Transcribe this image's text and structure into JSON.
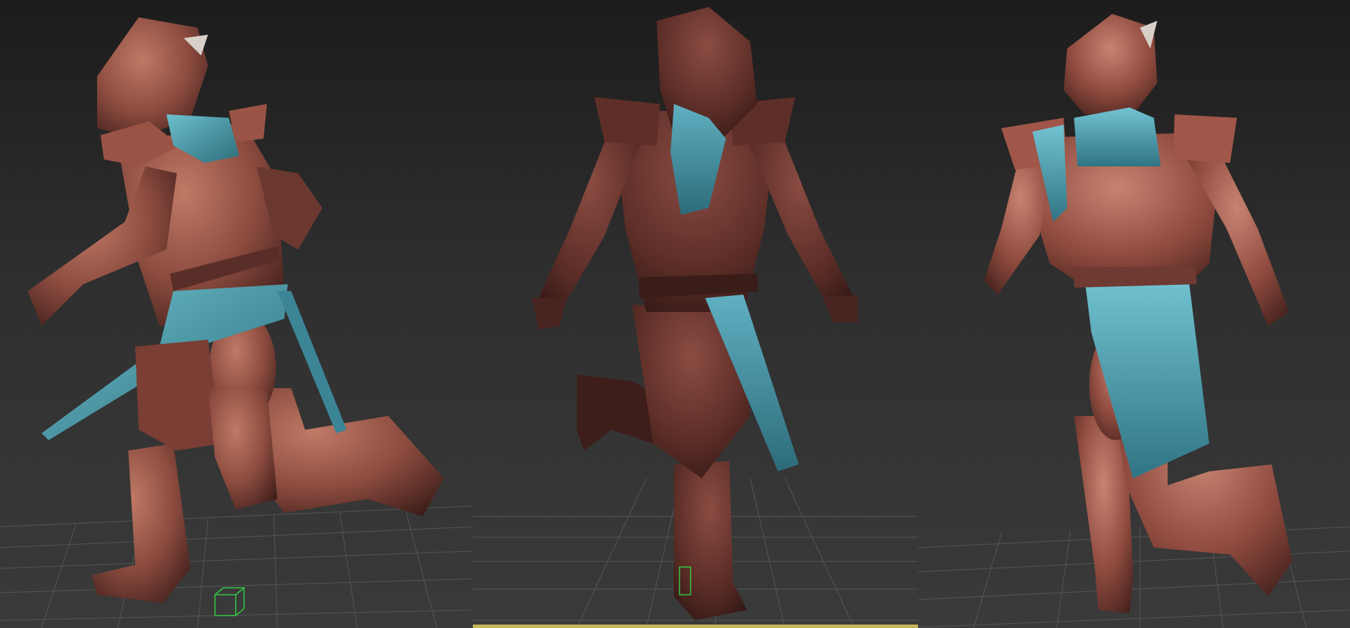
{
  "app": {
    "type": "3D modeling viewport layout"
  },
  "viewports": [
    {
      "id": "left",
      "label": "",
      "active": false,
      "view": "side"
    },
    {
      "id": "center",
      "label": "",
      "active": true,
      "view": "front"
    },
    {
      "id": "right",
      "label": "",
      "active": false,
      "view": "back"
    }
  ],
  "colors": {
    "armor": "#8a4a3e",
    "armor_dark": "#4a2420",
    "armor_highlight": "#c07a66",
    "cloth": "#4f9fb0",
    "grid": "#6a6a6a",
    "gizmo": "#33cc44",
    "active_border": "#c8b45a"
  },
  "icons": [
    "grid-plane",
    "helper-box-icon"
  ]
}
